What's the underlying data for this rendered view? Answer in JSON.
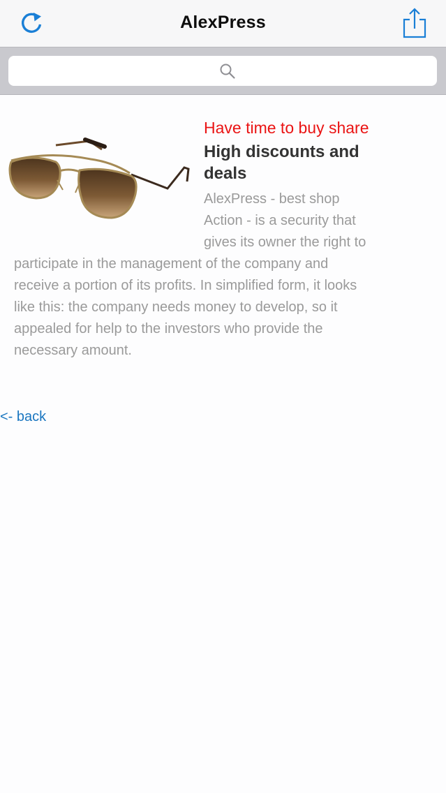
{
  "navbar": {
    "title": "AlexPress",
    "refresh_icon": "refresh-icon",
    "share_icon": "share-icon",
    "accent_color": "#1a7fd6"
  },
  "search": {
    "placeholder": "",
    "icon": "search-icon"
  },
  "article": {
    "image_alt": "sunglasses",
    "promo_text": "Have time to buy share",
    "promo_color": "#ea1414",
    "headline": "High discounts and deals",
    "description_lines": [
      "AlexPress - best shop",
      "Action - is a security that",
      "gives its owner the right to",
      "participate in the management of the company and",
      "receive a portion of its profits. In simplified form, it looks",
      "like this: the company needs money to develop, so it",
      "appealed for help to the investors who provide the",
      "necessary amount."
    ]
  },
  "back_link": {
    "label": "<- back"
  }
}
